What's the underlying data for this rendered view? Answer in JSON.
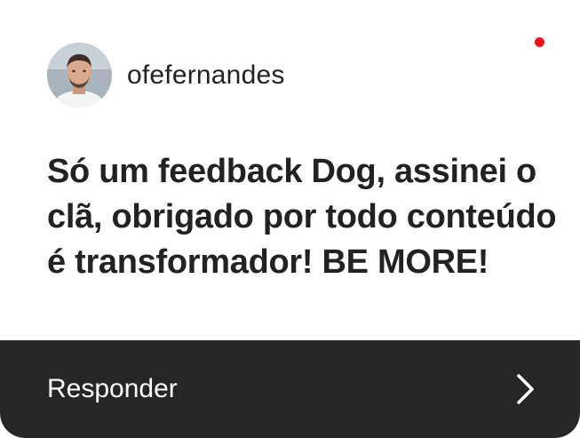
{
  "profile": {
    "username": "ofefernandes",
    "avatar_icon": "user-avatar-photo"
  },
  "notification": {
    "unread_indicator_color": "#e8141b"
  },
  "message": {
    "text": "Só um feedback Dog, assinei o clã, obrigado por todo conteúdo é transformador! BE MORE!"
  },
  "reply": {
    "label": "Responder",
    "icon": "chevron-right-icon",
    "background_color": "#262626"
  }
}
